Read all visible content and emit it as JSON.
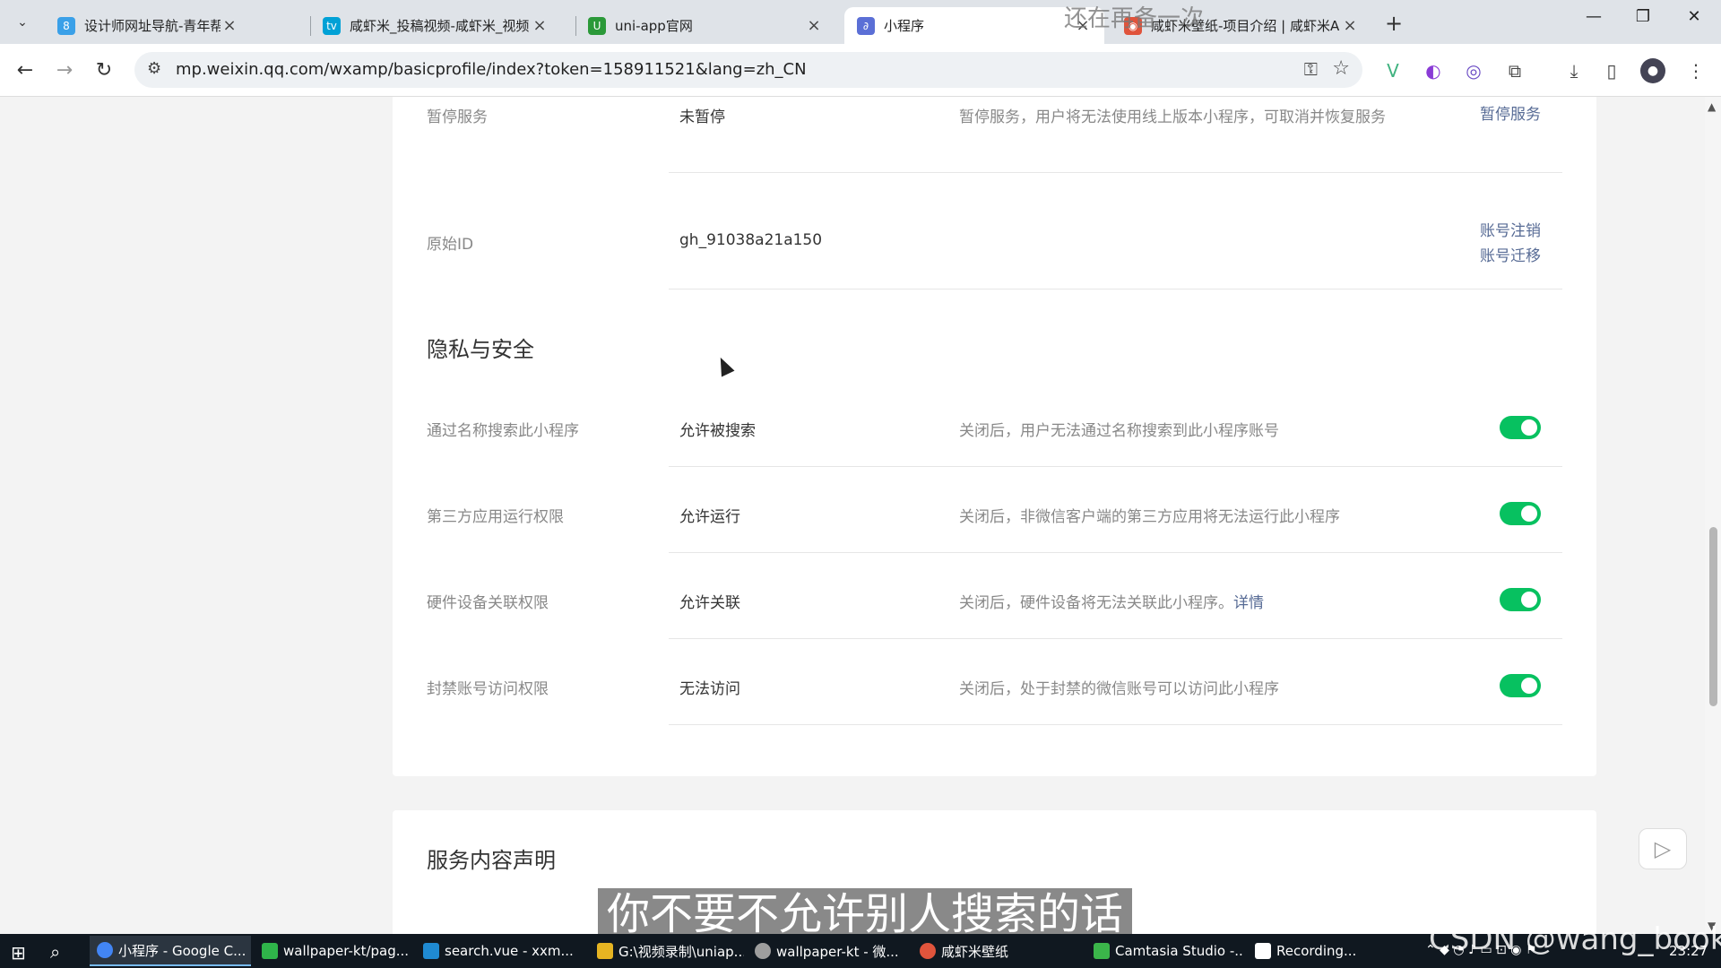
{
  "tabs": [
    {
      "title": "设计师网址导航-青年帮创意工",
      "favicon_color": "#3aa0e8",
      "favicon_glyph": "8"
    },
    {
      "title": "咸虾米_投稿视频-咸虾米_视频",
      "favicon_color": "#00a1d6",
      "favicon_glyph": "tv"
    },
    {
      "title": "uni-app官网",
      "favicon_color": "#2b9939",
      "favicon_glyph": "U"
    },
    {
      "title": "小程序",
      "favicon_color": "#5b6fd6",
      "favicon_glyph": "∂",
      "active": true
    },
    {
      "title": "咸虾米壁纸-项目介绍 | 咸虾米A",
      "favicon_color": "#e0543c",
      "favicon_glyph": "◉"
    }
  ],
  "toolbar": {
    "url": "mp.weixin.qq.com/wxamp/basicprofile/index?token=158911521&lang=zh_CN"
  },
  "top_section": {
    "paused_row": {
      "label": "暂停服务",
      "value": "未暂停",
      "desc": "暂停服务，用户将无法使用线上版本小程序，可取消并恢复服务",
      "action": "暂停服务"
    },
    "origin_row": {
      "label": "原始ID",
      "value": "gh_91038a21a150",
      "action_cancel": "账号注销",
      "action_migrate": "账号迁移"
    }
  },
  "privacy": {
    "title": "隐私与安全",
    "rows": [
      {
        "label": "通过名称搜索此小程序",
        "value": "允许被搜索",
        "desc": "关闭后，用户无法通过名称搜索到此小程序账号",
        "enabled": true
      },
      {
        "label": "第三方应用运行权限",
        "value": "允许运行",
        "desc": "关闭后，非微信客户端的第三方应用将无法运行此小程序",
        "enabled": true
      },
      {
        "label": "硬件设备关联权限",
        "value": "允许关联",
        "desc": "关闭后，硬件设备将无法关联此小程序。",
        "link": "详情",
        "enabled": true
      },
      {
        "label": "封禁账号访问权限",
        "value": "无法访问",
        "desc": "关闭后，处于封禁的微信账号可以访问此小程序",
        "enabled": true
      }
    ]
  },
  "service": {
    "title": "服务内容声明"
  },
  "overlay": {
    "subtitle": "你不要不允许别人搜索的话",
    "top_caption": "还在再备一次",
    "watermark": "CSDN @wang_book"
  },
  "taskbar": {
    "tasks": [
      {
        "label": "小程序 - Google C...",
        "color": "#4285f4"
      },
      {
        "label": "wallpaper-kt/pag...",
        "color": "#2fb44a"
      },
      {
        "label": "search.vue - xxm...",
        "color": "#1f8ad2"
      },
      {
        "label": "G:\\视频录制\\uniap...",
        "color": "#e6b422"
      },
      {
        "label": "wallpaper-kt - 微...",
        "color": "#9e9e9e"
      },
      {
        "label": "咸虾米壁纸",
        "color": "#e0543c"
      },
      {
        "label": "Camtasia Studio -...",
        "color": "#3bb54a"
      },
      {
        "label": "Recording...",
        "color": "#ffffff"
      }
    ],
    "time": "23:27"
  },
  "colors": {
    "toggle_on": "#07c160",
    "link": "#576b95"
  }
}
